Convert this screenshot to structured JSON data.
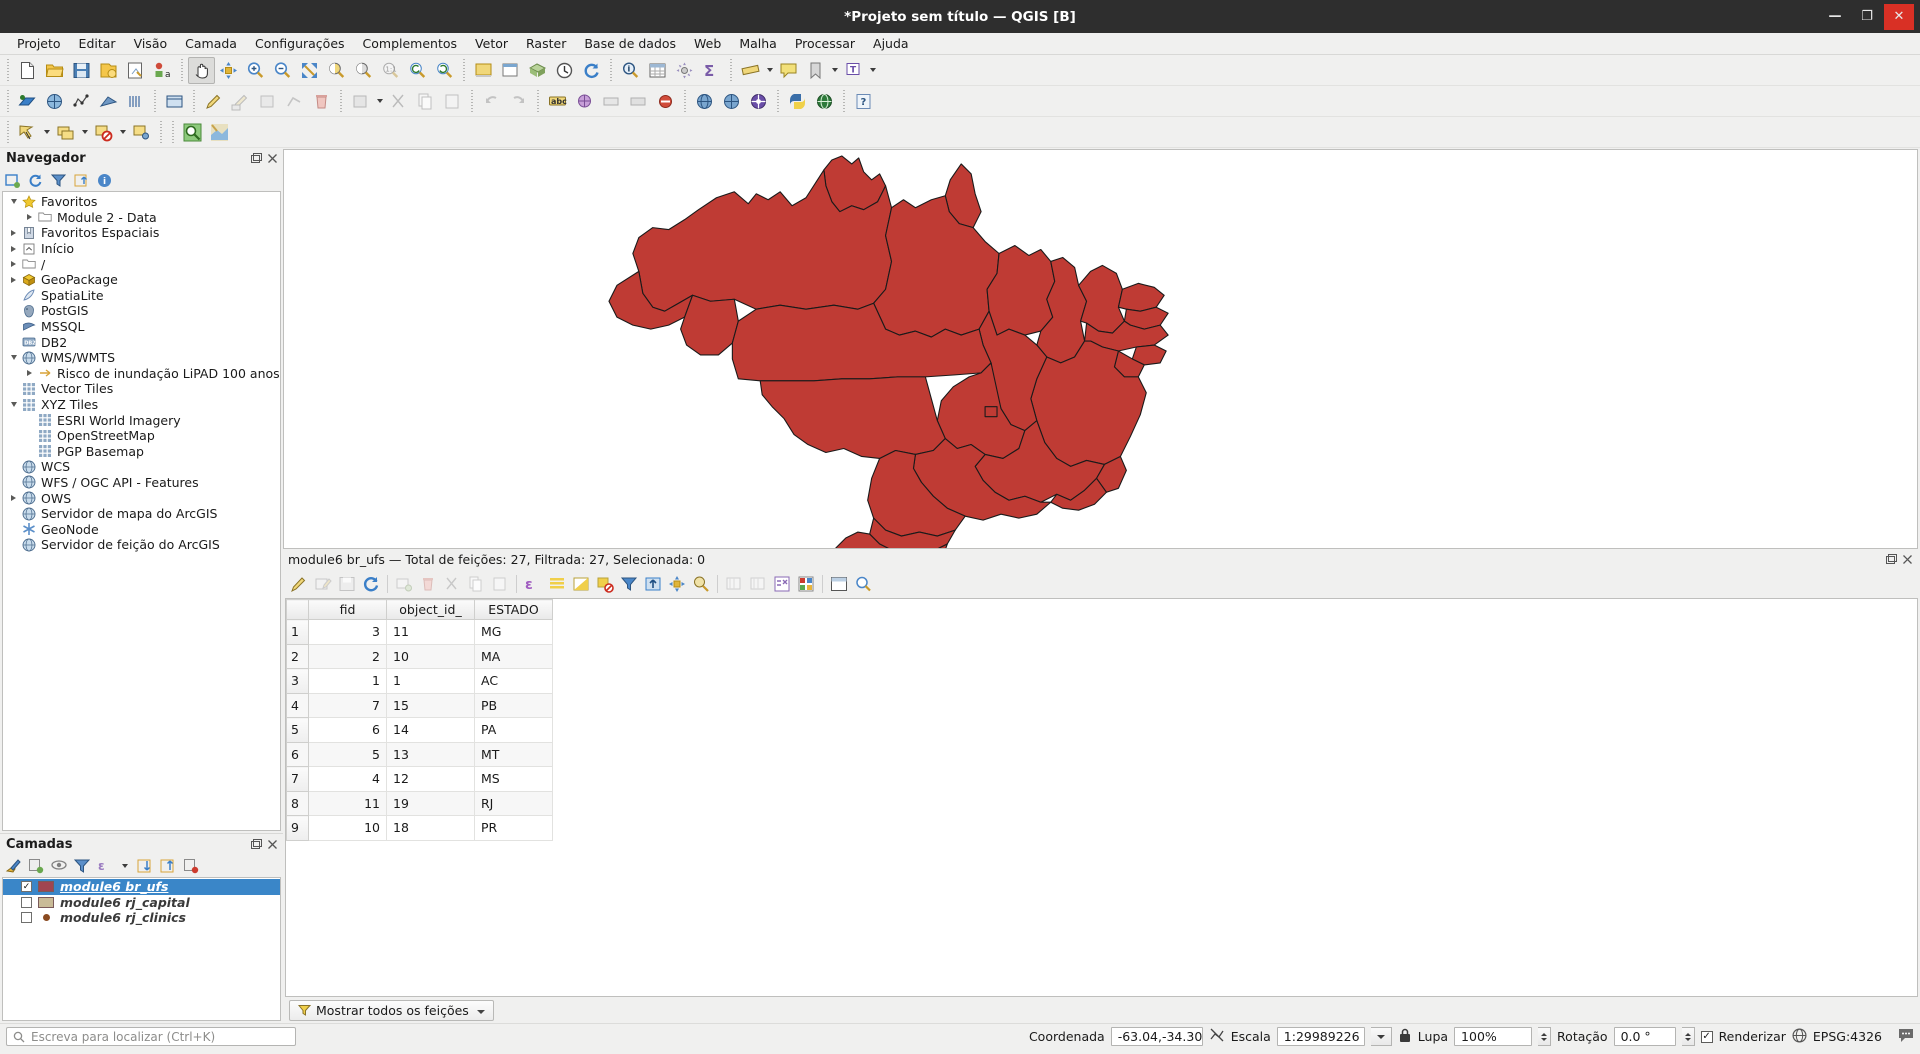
{
  "window": {
    "title": "*Projeto sem título — QGIS [B]",
    "minimize": "—",
    "maximize": "❐",
    "close": "✕"
  },
  "menubar": {
    "items": [
      {
        "label": "Projeto"
      },
      {
        "label": "Editar"
      },
      {
        "label": "Visão"
      },
      {
        "label": "Camada"
      },
      {
        "label": "Configurações"
      },
      {
        "label": "Complementos"
      },
      {
        "label": "Vetor"
      },
      {
        "label": "Raster"
      },
      {
        "label": "Base de dados"
      },
      {
        "label": "Web"
      },
      {
        "label": "Malha"
      },
      {
        "label": "Processar"
      },
      {
        "label": "Ajuda"
      }
    ]
  },
  "browser_panel": {
    "title": "Navegador",
    "toolbar_icons": [
      "add-layer-icon",
      "refresh-icon",
      "filter-icon",
      "collapse-all-icon",
      "info-icon"
    ],
    "tree": [
      {
        "label": "Favoritos",
        "icon": "star-icon",
        "expander": "down",
        "indent": 0
      },
      {
        "label": "Module 2 - Data",
        "icon": "folder-icon",
        "expander": "right",
        "indent": 1
      },
      {
        "label": "Favoritos Espaciais",
        "icon": "bookmark-icon",
        "expander": "right",
        "indent": 0
      },
      {
        "label": "Início",
        "icon": "home-icon",
        "expander": "right",
        "indent": 0
      },
      {
        "label": "/",
        "icon": "folder-icon",
        "expander": "right",
        "indent": 0
      },
      {
        "label": "GeoPackage",
        "icon": "geopackage-icon",
        "expander": "right",
        "indent": 0
      },
      {
        "label": "SpatiaLite",
        "icon": "spatialite-icon",
        "expander": "none",
        "indent": 0
      },
      {
        "label": "PostGIS",
        "icon": "postgis-icon",
        "expander": "none",
        "indent": 0
      },
      {
        "label": "MSSQL",
        "icon": "mssql-icon",
        "expander": "none",
        "indent": 0
      },
      {
        "label": "DB2",
        "icon": "db2-icon",
        "expander": "none",
        "indent": 0
      },
      {
        "label": "WMS/WMTS",
        "icon": "globe-icon",
        "expander": "down",
        "indent": 0
      },
      {
        "label": "Risco de inundação LiPAD 100 anos",
        "icon": "wms-connection-icon",
        "expander": "right",
        "indent": 1
      },
      {
        "label": "Vector Tiles",
        "icon": "tiles-icon",
        "expander": "none",
        "indent": 0
      },
      {
        "label": "XYZ Tiles",
        "icon": "tiles-icon",
        "expander": "down",
        "indent": 0
      },
      {
        "label": "ESRI World Imagery",
        "icon": "tiles-icon",
        "expander": "none",
        "indent": 1
      },
      {
        "label": "OpenStreetMap",
        "icon": "tiles-icon",
        "expander": "none",
        "indent": 1
      },
      {
        "label": "PGP Basemap",
        "icon": "tiles-icon",
        "expander": "none",
        "indent": 1
      },
      {
        "label": "WCS",
        "icon": "globe-icon",
        "expander": "none",
        "indent": 0
      },
      {
        "label": "WFS / OGC API - Features",
        "icon": "globe-icon",
        "expander": "none",
        "indent": 0
      },
      {
        "label": "OWS",
        "icon": "globe-icon",
        "expander": "right",
        "indent": 0
      },
      {
        "label": "Servidor de mapa do ArcGIS",
        "icon": "globe-icon",
        "expander": "none",
        "indent": 0
      },
      {
        "label": "GeoNode",
        "icon": "geonode-icon",
        "expander": "none",
        "indent": 0
      },
      {
        "label": "Servidor de feição do ArcGIS",
        "icon": "globe-icon",
        "expander": "none",
        "indent": 0
      }
    ]
  },
  "layers_panel": {
    "title": "Camadas",
    "toolbar_icons": [
      "style-manager-icon",
      "add-group-icon",
      "manage-visibility-icon",
      "filter-legend-icon",
      "expression-filter-icon",
      "expand-all-icon",
      "collapse-all-icon",
      "remove-layer-icon"
    ],
    "layers": [
      {
        "name": "module6 br_ufs",
        "checked": true,
        "selected": true,
        "symbol": "polygon",
        "color": "#a14550"
      },
      {
        "name": "module6 rj_capital",
        "checked": false,
        "selected": false,
        "symbol": "polygon",
        "color": "#c9bb97"
      },
      {
        "name": "module6 rj_clinics",
        "checked": false,
        "selected": false,
        "symbol": "point",
        "color": "#8a4a20"
      }
    ]
  },
  "map": {
    "fill_color": "#bf3b34",
    "stroke_color": "#1a1a1a",
    "background": "#ffffff"
  },
  "attribute_table": {
    "header_text": "module6 br_ufs — Total de feições: 27, Filtrada: 27, Selecionada: 0",
    "columns": [
      "fid",
      "object_id_",
      "ESTADO"
    ],
    "rows": [
      {
        "n": "1",
        "fid": "3",
        "object_id_": "11",
        "ESTADO": "MG"
      },
      {
        "n": "2",
        "fid": "2",
        "object_id_": "10",
        "ESTADO": "MA"
      },
      {
        "n": "3",
        "fid": "1",
        "object_id_": "1",
        "ESTADO": "AC"
      },
      {
        "n": "4",
        "fid": "7",
        "object_id_": "15",
        "ESTADO": "PB"
      },
      {
        "n": "5",
        "fid": "6",
        "object_id_": "14",
        "ESTADO": "PA"
      },
      {
        "n": "6",
        "fid": "5",
        "object_id_": "13",
        "ESTADO": "MT"
      },
      {
        "n": "7",
        "fid": "4",
        "object_id_": "12",
        "ESTADO": "MS"
      },
      {
        "n": "8",
        "fid": "11",
        "object_id_": "19",
        "ESTADO": "RJ"
      },
      {
        "n": "9",
        "fid": "10",
        "object_id_": "18",
        "ESTADO": "PR"
      }
    ],
    "show_all_button": "Mostrar todos os feições"
  },
  "statusbar": {
    "locator_placeholder": "Escreva para localizar (Ctrl+K)",
    "coordinate_label": "Coordenada",
    "coordinate_value": "-63.04,-34.30",
    "scale_label": "Escala",
    "scale_value": "1:29989226",
    "magnifier_label": "Lupa",
    "magnifier_value": "100%",
    "rotation_label": "Rotação",
    "rotation_value": "0.0 °",
    "render_label": "Renderizar",
    "render_checked": "✓",
    "crs_label": "EPSG:4326"
  }
}
